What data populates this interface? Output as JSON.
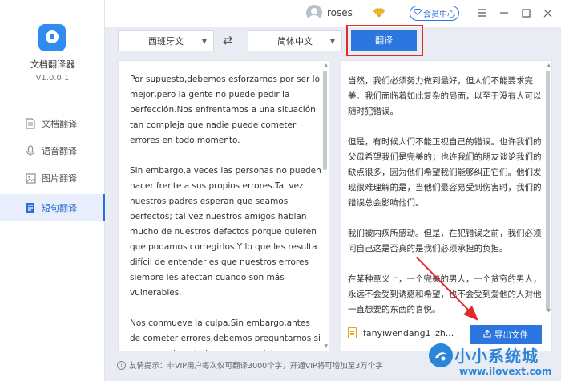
{
  "titlebar": {
    "username": "roses",
    "vip_label": "会员中心",
    "controls": [
      "minimize",
      "maximize",
      "close"
    ]
  },
  "sidebar": {
    "app_name": "文档翻译器",
    "version": "V1.0.0.1",
    "items": [
      {
        "label": "文档翻译",
        "icon": "document-icon",
        "active": false
      },
      {
        "label": "语音翻译",
        "icon": "microphone-icon",
        "active": false
      },
      {
        "label": "图片翻译",
        "icon": "image-icon",
        "active": false
      },
      {
        "label": "短句翻译",
        "icon": "sentence-icon",
        "active": true
      }
    ]
  },
  "toolbar": {
    "source_language": "西班牙文",
    "target_language": "简体中文",
    "translate_label": "翻译"
  },
  "source_panel": {
    "paragraphs": [
      "Por supuesto,debemos esforzarnos por ser lo mejor,pero la gente no puede pedir la perfección.Nos enfrentamos a una situación tan compleja que nadie puede cometer errores en todo momento.",
      "Sin embargo,a veces las personas no pueden hacer frente a sus propios errores.Tal vez nuestros padres esperan que seamos perfectos; tal vez nuestros amigos hablan mucho de nuestros defectos porque quieren que podamos corregirlos.Y lo que les resulta difícil de entender es que nuestros errores siempre les afectan cuando son más vulnerables.",
      "Nos conmueve la culpa.Sin embargo,antes de cometer errores,debemos preguntarnos si esa es realmente la carga que debemos asumir."
    ]
  },
  "target_panel": {
    "paragraphs": [
      "当然，我们必须努力做到最好，但人们不能要求完美。我们面临着如此复杂的局面，以至于没有人可以随时犯错误。",
      "但是，有时候人们不能正视自己的错误。也许我们的父母希望我们是完美的；也许我们的朋友谈论我们的缺点很多，因为他们希望我们能够纠正它们。他们发现很难理解的是，当他们最容易受到伤害时，我们的错误总会影响他们。",
      "我们被内疚所感动。但是，在犯错误之前，我们必须问自己这是否真的是我们必须承担的负担。",
      "在某种意义上，一个完美的男人，一个贫穷的男人，永远不会受到诱惑和希望，也不会受到爱他的人对他一直想要的东西的喜悦。"
    ],
    "file_name": "fanyiwendang1_zh...",
    "export_label": "导出文件"
  },
  "footer": {
    "tip": "友情提示：非VIP用户每次仅可翻译3000个字，开通VIP将可增加至3万个字"
  },
  "watermark": {
    "title": "小小系统城",
    "url": "www.ilovext.com"
  },
  "colors": {
    "accent": "#2c76e0",
    "highlight": "#e02b2b",
    "vip_gold": "#e6a819"
  }
}
